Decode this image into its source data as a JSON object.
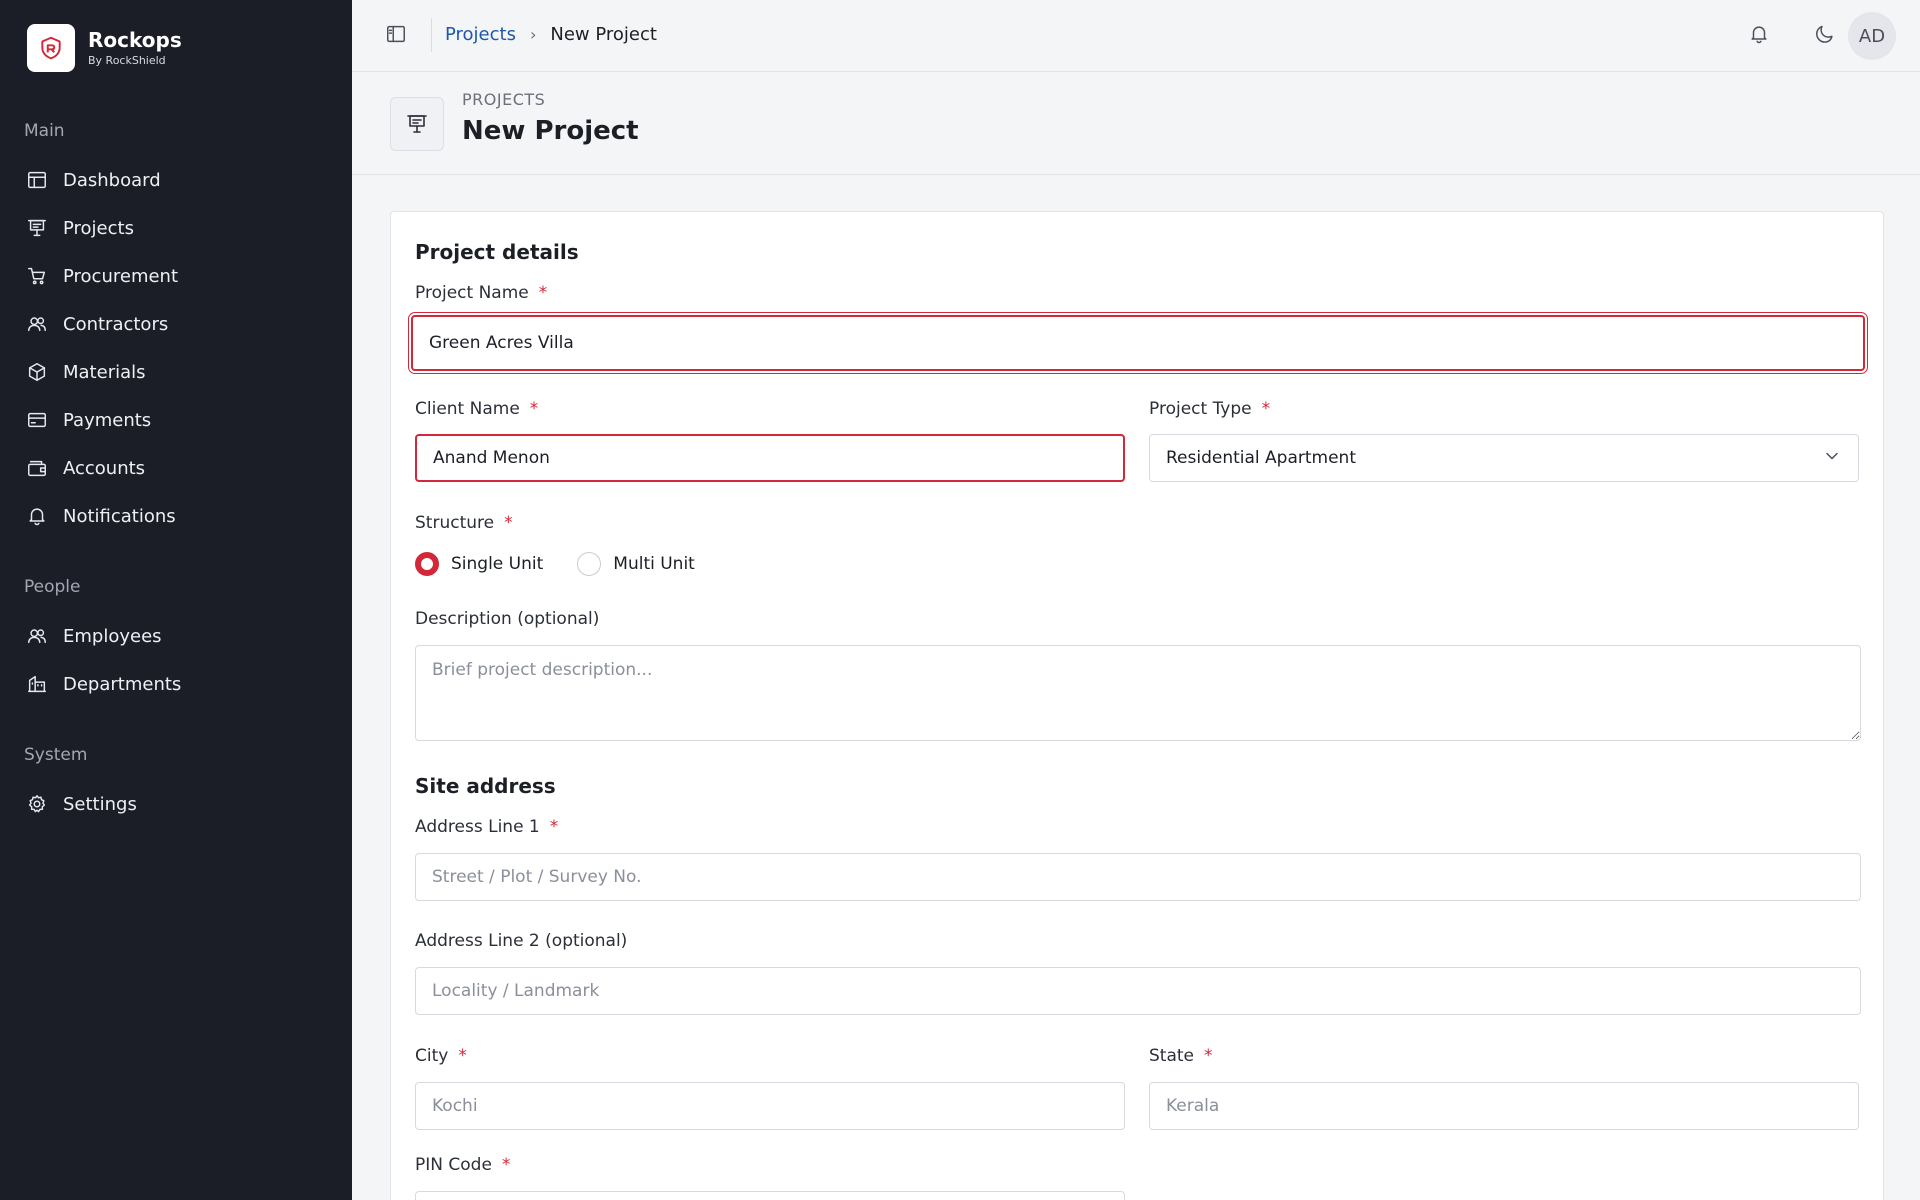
{
  "brand": {
    "name": "Rockops",
    "sub": "By RockShield"
  },
  "sidebar": {
    "groups": [
      {
        "title": "Main",
        "items": [
          {
            "label": "Dashboard",
            "icon": "dashboard-icon"
          },
          {
            "label": "Projects",
            "icon": "projects-icon"
          },
          {
            "label": "Procurement",
            "icon": "cart-icon"
          },
          {
            "label": "Contractors",
            "icon": "users-icon"
          },
          {
            "label": "Materials",
            "icon": "box-icon"
          },
          {
            "label": "Payments",
            "icon": "card-icon"
          },
          {
            "label": "Accounts",
            "icon": "wallet-icon"
          },
          {
            "label": "Notifications",
            "icon": "bell-icon"
          }
        ]
      },
      {
        "title": "People",
        "items": [
          {
            "label": "Employees",
            "icon": "users-icon"
          },
          {
            "label": "Departments",
            "icon": "building-icon"
          }
        ]
      },
      {
        "title": "System",
        "items": [
          {
            "label": "Settings",
            "icon": "gear-icon"
          }
        ]
      }
    ]
  },
  "header": {
    "breadcrumb": {
      "parent": "Projects",
      "separator": "›",
      "current": "New Project"
    },
    "avatar": "AD"
  },
  "page": {
    "eyebrow": "PROJECTS",
    "title": "New Project"
  },
  "form": {
    "details_title": "Project details",
    "project_name": {
      "label": "Project Name",
      "value": "Green Acres Villa"
    },
    "client_name": {
      "label": "Client Name",
      "value": "Anand Menon"
    },
    "project_type": {
      "label": "Project Type",
      "value": "Residential Apartment"
    },
    "structure": {
      "label": "Structure",
      "options": [
        "Single Unit",
        "Multi Unit"
      ],
      "selected": "Single Unit"
    },
    "description": {
      "label": "Description (optional)",
      "placeholder": "Brief project description..."
    },
    "address_title": "Site address",
    "address1": {
      "label": "Address Line 1",
      "placeholder": "Street / Plot / Survey No."
    },
    "address2": {
      "label": "Address Line 2 (optional)",
      "placeholder": "Locality / Landmark"
    },
    "city": {
      "label": "City",
      "placeholder": "Kochi"
    },
    "state": {
      "label": "State",
      "placeholder": "Kerala"
    },
    "pin": {
      "label": "PIN Code"
    },
    "required_mark": "*"
  },
  "colors": {
    "accent": "#d3273a",
    "sidebar": "#1b1e27",
    "link": "#1f57a8"
  }
}
